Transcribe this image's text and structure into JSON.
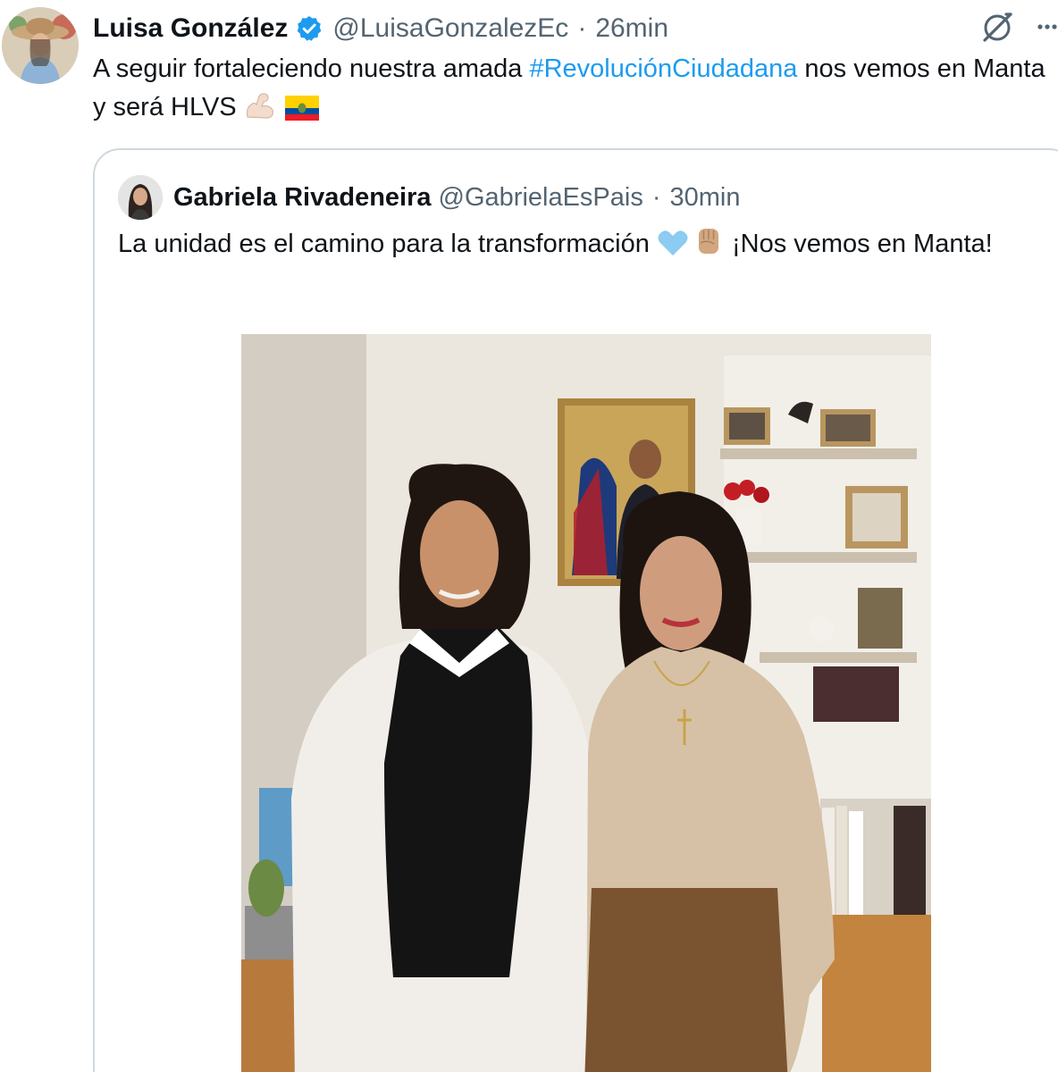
{
  "tweet": {
    "author_name": "Luisa González",
    "author_handle": "@LuisaGonzalezEc",
    "separator": "·",
    "time": "26min",
    "text_before": "A seguir fortaleciendo nuestra amada ",
    "hashtag": "#RevoluciónCiudadana",
    "text_after": " nos vemos en Manta y será HLVS "
  },
  "quote": {
    "author_name": "Gabriela Rivadeneira",
    "author_handle": "@GabrielaEsPais",
    "separator": "·",
    "time": "30min",
    "text_before": "La unidad es el camino para la transformación ",
    "text_after": " ¡Nos vemos en Manta!"
  },
  "icons": {
    "verified": "verified-badge-icon",
    "grok": "grok-icon",
    "more": "more-options-icon",
    "muscle": "flexed-biceps-emoji",
    "flag": "ecuador-flag-emoji",
    "heart": "light-blue-heart-emoji",
    "fist": "raised-fist-emoji"
  },
  "colors": {
    "hashtag": "#1d9bf0",
    "verified": "#1d9bf0",
    "secondary_text": "#536471",
    "border": "#cfd9de"
  }
}
